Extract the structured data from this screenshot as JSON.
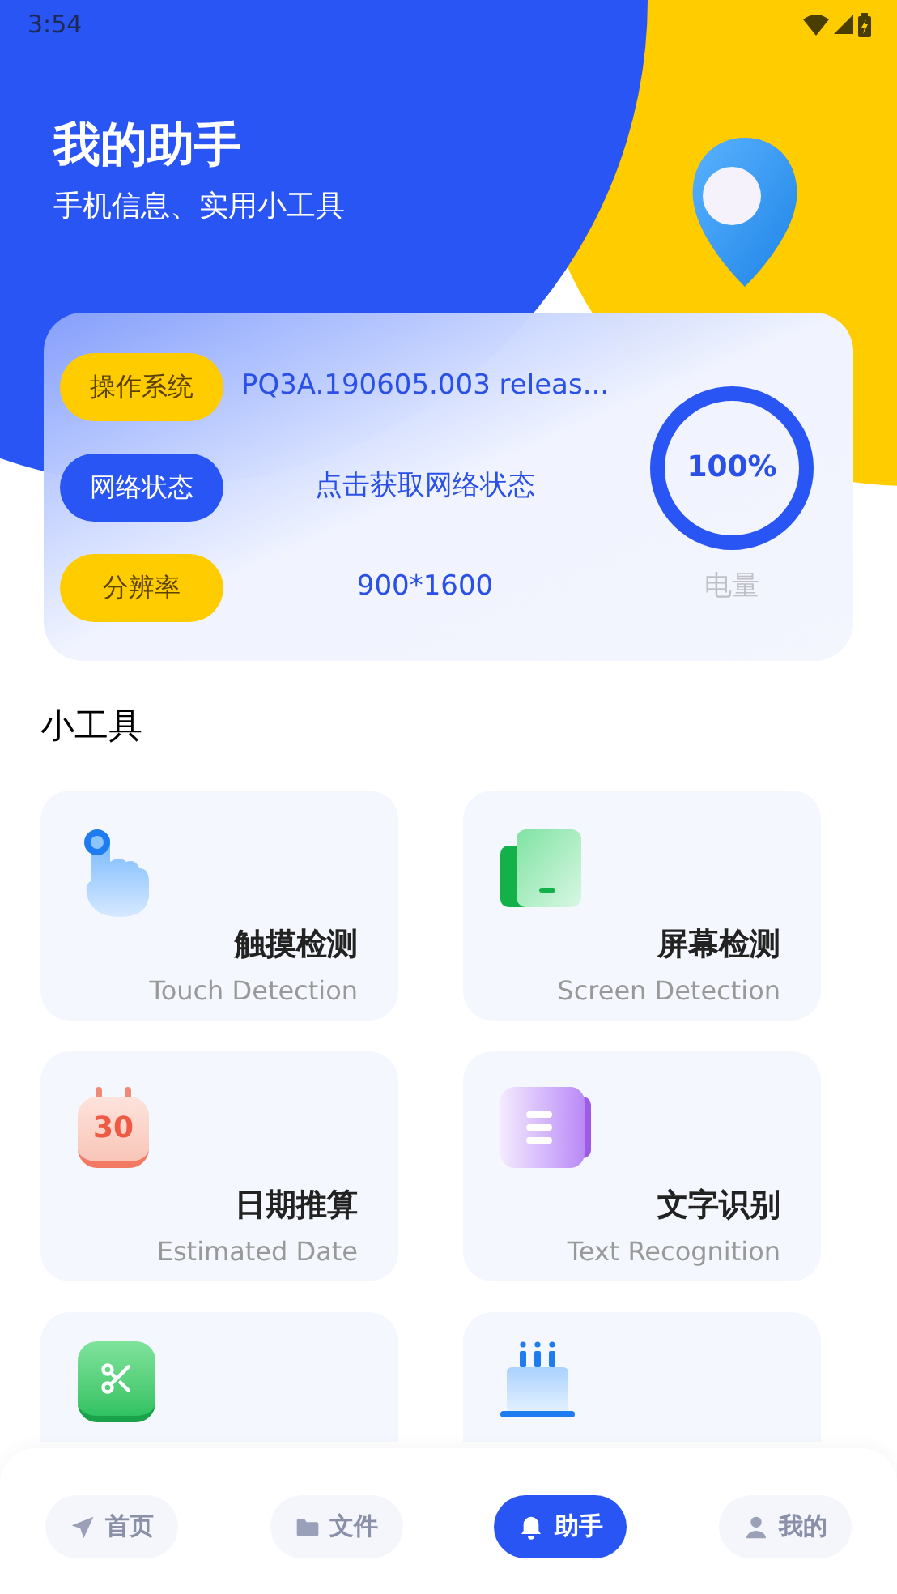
{
  "status_bar": {
    "time": "3:54"
  },
  "header": {
    "title": "我的助手",
    "subtitle": "手机信息、实用小工具"
  },
  "info": {
    "rows": [
      {
        "label": "操作系统",
        "color": "#ffcc00",
        "value": "PQ3A.190605.003 releas..."
      },
      {
        "label": "网络状态",
        "color": "#2a55f5",
        "value": "点击获取网络状态"
      },
      {
        "label": "分辨率",
        "color": "#ffcc00",
        "value": "900*1600"
      }
    ],
    "battery": {
      "level": 1,
      "reading": "100%",
      "label": "电量"
    }
  },
  "section_title": "小工具",
  "tools": [
    {
      "kind": "touch",
      "title": "触摸检测",
      "subtitle": "Touch Detection"
    },
    {
      "kind": "screen",
      "title": "屏幕检测",
      "subtitle": "Screen Detection"
    },
    {
      "kind": "date",
      "title": "日期推算",
      "subtitle": "Estimated Date",
      "icon_text": "30"
    },
    {
      "kind": "text",
      "title": "文字识别",
      "subtitle": "Text Recognition"
    },
    {
      "kind": "crop"
    },
    {
      "kind": "cake"
    }
  ],
  "nav": [
    {
      "kind": "send",
      "label": "首页",
      "selected": false
    },
    {
      "kind": "folder",
      "label": "文件",
      "selected": false
    },
    {
      "kind": "bell",
      "label": "助手",
      "selected": true
    },
    {
      "kind": "user",
      "label": "我的",
      "selected": false
    }
  ]
}
